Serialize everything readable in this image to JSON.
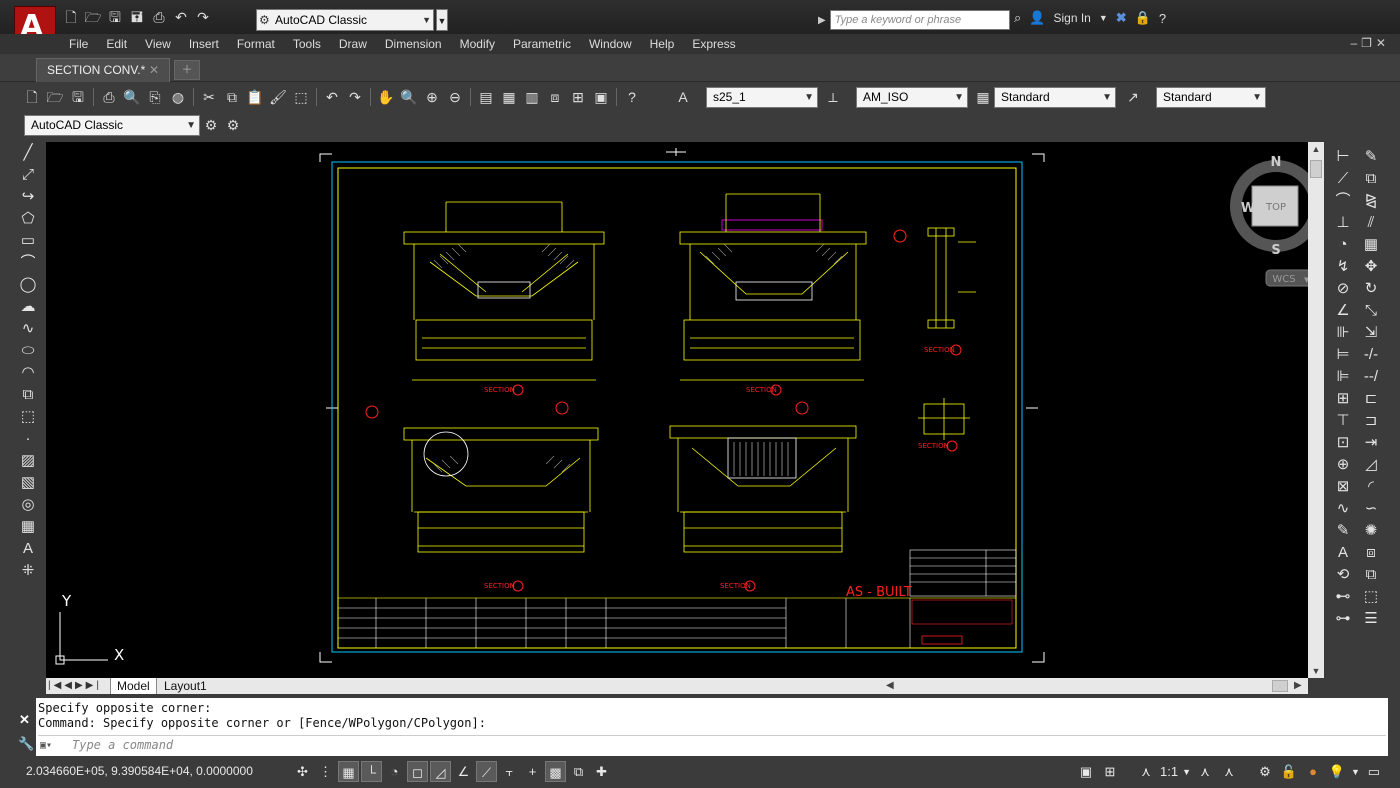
{
  "app": {
    "workspace": "AutoCAD Classic",
    "search_placeholder": "Type a keyword or phrase",
    "sign_in": "Sign In"
  },
  "menu": [
    "File",
    "Edit",
    "View",
    "Insert",
    "Format",
    "Tools",
    "Draw",
    "Dimension",
    "Modify",
    "Parametric",
    "Window",
    "Help",
    "Express"
  ],
  "document_tab": "SECTION CONV.*",
  "toolbar": {
    "text_style": "s25_1",
    "dim_style": "AM_ISO",
    "table_style": "Standard",
    "multileader_style": "Standard",
    "workspace": "AutoCAD Classic"
  },
  "viewcube": {
    "north": "N",
    "south": "S",
    "east": "E",
    "west": "W",
    "face": "TOP",
    "ucs": "WCS"
  },
  "ucs_icon": {
    "y": "Y",
    "x": "X"
  },
  "drawing": {
    "stamp": "AS - BUILT",
    "section_labels": [
      "SECTION",
      "SECTION",
      "SECTION",
      "SECTION",
      "SECTION",
      "SECTION",
      "SECTION"
    ]
  },
  "layout_tabs": [
    "Model",
    "Layout1"
  ],
  "command": {
    "history": [
      "Specify opposite corner:",
      "Command: Specify opposite corner or [Fence/WPolygon/CPolygon]:"
    ],
    "placeholder": "Type a command"
  },
  "status": {
    "coordinates": "2.034660E+05, 9.390584E+04, 0.0000000",
    "annotation_scale": "1:1"
  },
  "colors": {
    "canvas": "#000000",
    "border": "#00c8ff",
    "geometry": "#ffff00",
    "accent": "#ff2020",
    "text": "#ffffff"
  }
}
